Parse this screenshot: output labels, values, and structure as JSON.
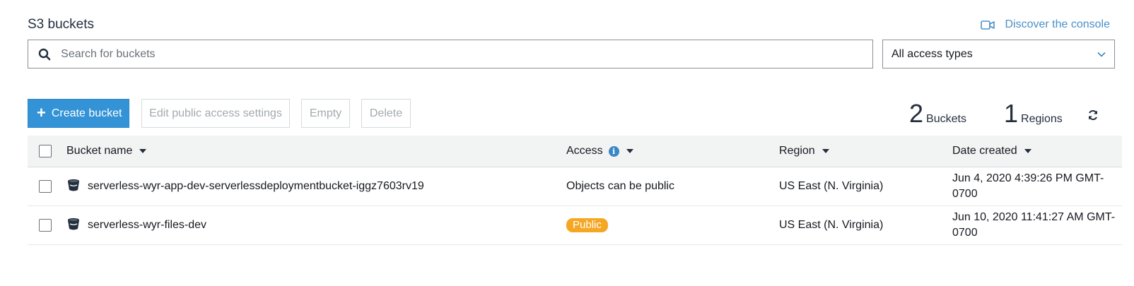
{
  "page_title": "S3 buckets",
  "discover_link": {
    "label": "Discover the console",
    "icon": "video-camera-icon"
  },
  "search": {
    "placeholder": "Search for buckets",
    "value": ""
  },
  "access_filter": {
    "selected": "All access types"
  },
  "toolbar": {
    "create_label": "Create bucket",
    "edit_label": "Edit public access settings",
    "empty_label": "Empty",
    "delete_label": "Delete"
  },
  "stats": {
    "buckets_count": "2",
    "buckets_label": "Buckets",
    "regions_count": "1",
    "regions_label": "Regions"
  },
  "table": {
    "headers": {
      "name": "Bucket name",
      "access": "Access",
      "region": "Region",
      "date": "Date created"
    },
    "rows": [
      {
        "name": "serverless-wyr-app-dev-serverlessdeploymentbucket-iggz7603rv19",
        "access": "Objects can be public",
        "region": "US East (N. Virginia)",
        "date": "Jun 4, 2020 4:39:26 PM GMT-0700"
      },
      {
        "name": "serverless-wyr-files-dev",
        "access": "Public",
        "region": "US East (N. Virginia)",
        "date": "Jun 10, 2020 11:41:27 AM GMT-0700"
      }
    ]
  },
  "colors": {
    "primary": "#3393d6",
    "link": "#4a90c8",
    "public_badge": "#f5a623"
  }
}
